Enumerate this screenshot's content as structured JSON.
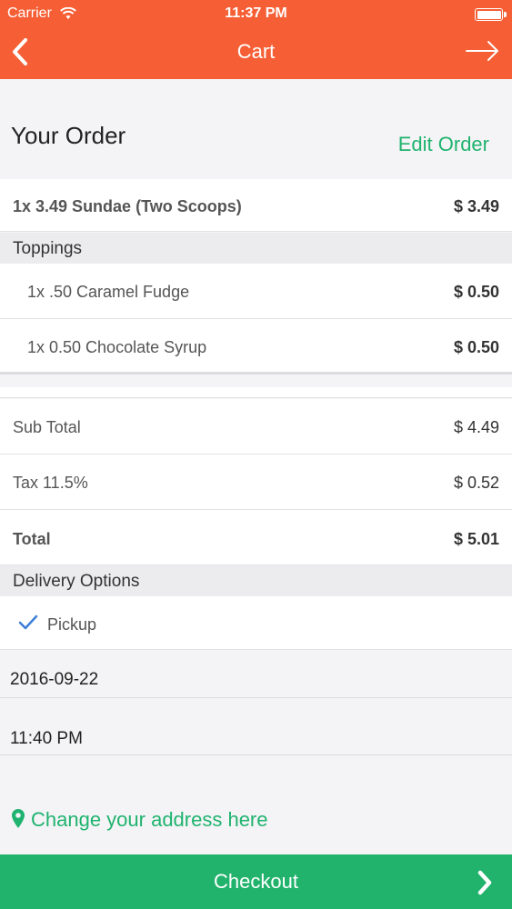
{
  "status_bar": {
    "carrier": "Carrier",
    "time": "11:37 PM"
  },
  "nav": {
    "title": "Cart"
  },
  "order": {
    "title": "Your Order",
    "edit_label": "Edit Order"
  },
  "main_item": {
    "label": "1x 3.49 Sundae (Two Scoops)",
    "price": "$ 3.49"
  },
  "toppings": {
    "header": "Toppings",
    "items": [
      {
        "label": "1x .50 Caramel Fudge",
        "price": "$ 0.50"
      },
      {
        "label": "1x 0.50 Chocolate Syrup",
        "price": "$ 0.50"
      }
    ]
  },
  "totals": {
    "subtotal_label": "Sub Total",
    "subtotal": "$ 4.49",
    "tax_label": "Tax 11.5%",
    "tax": "$ 0.52",
    "total_label": "Total",
    "total": "$ 5.01"
  },
  "delivery": {
    "header": "Delivery Options",
    "selected_option": "Pickup",
    "date": "2016-09-22",
    "time": "11:40 PM",
    "address_link": "Change your address here"
  },
  "checkout": {
    "label": "Checkout"
  },
  "colors": {
    "header": "#f65f35",
    "accent": "#20b36f",
    "checkout": "#21b36c"
  },
  "icons": [
    "back-chevron-icon",
    "forward-arrow-icon",
    "wifi-icon",
    "battery-icon",
    "checkmark-icon",
    "location-pin-icon",
    "chevron-right-icon"
  ]
}
